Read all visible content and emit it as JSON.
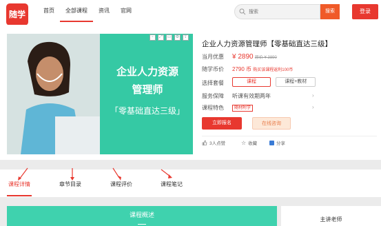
{
  "header": {
    "logo_text": "随学",
    "nav": [
      "首页",
      "全部课程",
      "资讯",
      "官网"
    ],
    "active_nav_index": 1,
    "search_placeholder": "搜索",
    "search_button": "搜索",
    "login_button": "登录"
  },
  "course": {
    "banner": {
      "line1": "企业人力资源",
      "line2": "管理师",
      "line3": "「零基础直达三级」"
    },
    "title": "企业人力资源管理师【零基础直达三级】",
    "rows": {
      "price_label": "当月优惠",
      "price": "¥ 2890",
      "original_price": "原价 ¥ 3890",
      "coin_label": "随学币价",
      "coin_price": "2790 币",
      "coin_note": "购买该课程返利100币",
      "package_label": "选择套餐",
      "package_options": [
        "课程",
        "课程+教材"
      ],
      "selected_package_index": 0,
      "service_label": "服务保障",
      "service_value": "听课有效期两年",
      "feature_label": "课程特色",
      "feature_tag": "随材附学"
    },
    "signup_button": "立即报名",
    "consult_button": "在线咨询",
    "meta": {
      "likes": "3人点赞",
      "collect": "收藏",
      "share": "分享"
    }
  },
  "tabs": {
    "items": [
      "课程详情",
      "章节目录",
      "课程评价",
      "课程笔记"
    ],
    "active_index": 0
  },
  "bottom": {
    "overview": "课程概述",
    "teacher": "主讲老师"
  },
  "colors": {
    "brand_red": "#e8382f",
    "banner_green": "#35c9a4",
    "search_orange": "#f05a28"
  }
}
